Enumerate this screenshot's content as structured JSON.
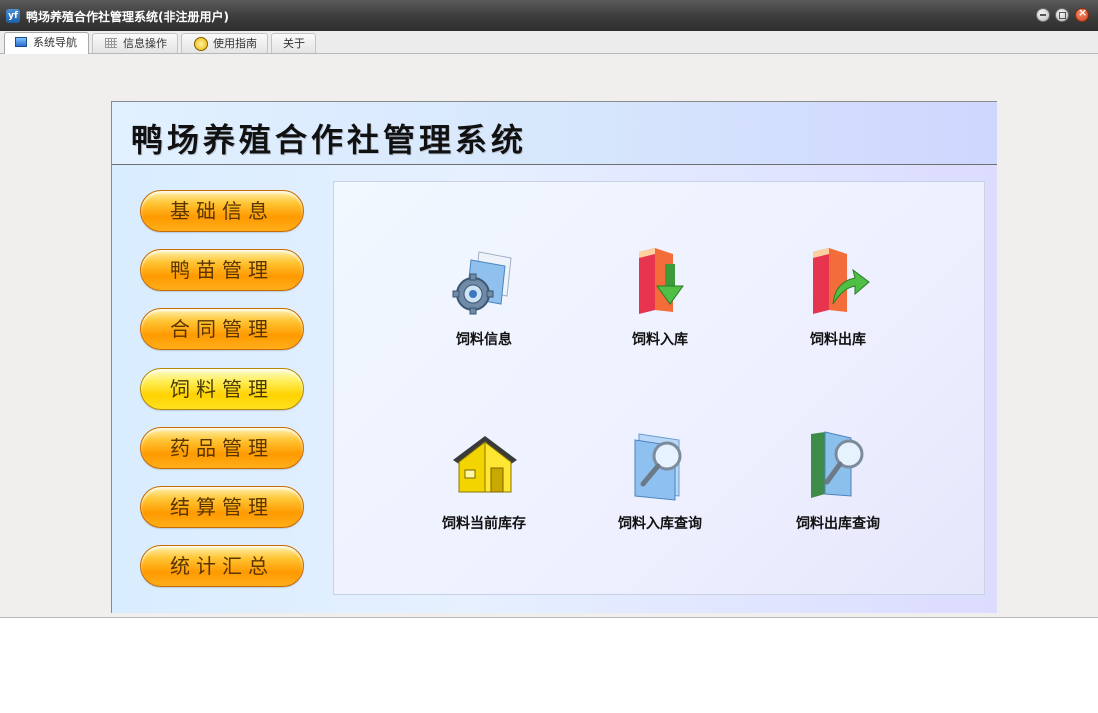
{
  "window": {
    "title": "鸭场养殖合作社管理系统(非注册用户)",
    "app_icon_text": "yf"
  },
  "tabs": [
    {
      "label": "系统导航",
      "icon": "monitor-icon",
      "active": true
    },
    {
      "label": "信息操作",
      "icon": "grid-icon",
      "active": false
    },
    {
      "label": "使用指南",
      "icon": "help-icon",
      "active": false
    },
    {
      "label": "关于",
      "icon": "",
      "active": false
    }
  ],
  "header": {
    "title": "鸭场养殖合作社管理系统"
  },
  "sidebar": {
    "items": [
      {
        "label": "基础信息",
        "active": false
      },
      {
        "label": "鸭苗管理",
        "active": false
      },
      {
        "label": "合同管理",
        "active": false
      },
      {
        "label": "饲料管理",
        "active": true
      },
      {
        "label": "药品管理",
        "active": false
      },
      {
        "label": "结算管理",
        "active": false
      },
      {
        "label": "统计汇总",
        "active": false
      }
    ]
  },
  "actions": [
    {
      "label": "饲料信息",
      "icon": "settings-folder-icon"
    },
    {
      "label": "饲料入库",
      "icon": "book-in-arrow-icon"
    },
    {
      "label": "饲料出库",
      "icon": "book-out-arrow-icon"
    },
    {
      "label": "饲料当前库存",
      "icon": "warehouse-icon"
    },
    {
      "label": "饲料入库查询",
      "icon": "search-folder-icon"
    },
    {
      "label": "饲料出库查询",
      "icon": "search-book-icon"
    }
  ],
  "colors": {
    "pill_orange": "#ff9a00",
    "pill_yellow": "#ffd200",
    "titlebar": "#3c3c3c"
  }
}
